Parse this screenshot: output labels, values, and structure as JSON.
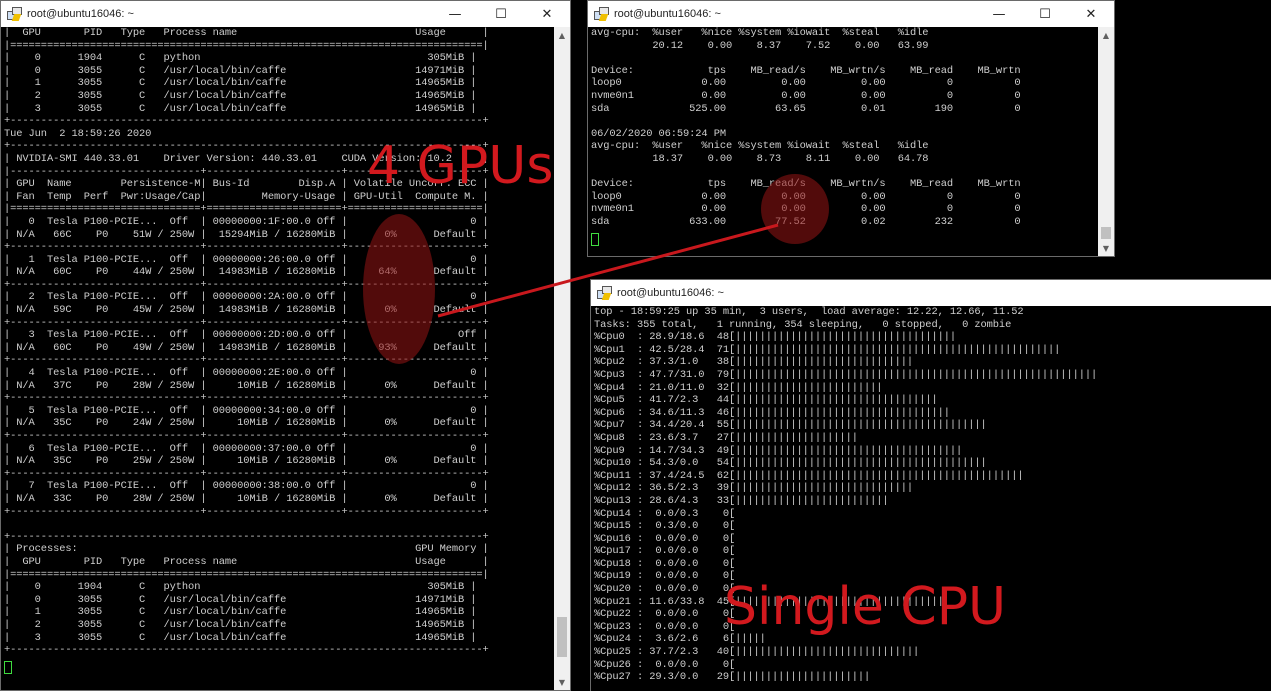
{
  "nvidia_window": {
    "title": "root@ubuntu16046: ~",
    "lines": [
      "|  GPU       PID   Type   Process name                             Usage      |",
      "|=============================================================================|",
      "|    0      1904      C   python                                     305MiB |",
      "|    0      3055      C   /usr/local/bin/caffe                     14971MiB |",
      "|    1      3055      C   /usr/local/bin/caffe                     14965MiB |",
      "|    2      3055      C   /usr/local/bin/caffe                     14965MiB |",
      "|    3      3055      C   /usr/local/bin/caffe                     14965MiB |",
      "+-----------------------------------------------------------------------------+",
      "Tue Jun  2 18:59:26 2020",
      "+-----------------------------------------------------------------------------+",
      "| NVIDIA-SMI 440.33.01    Driver Version: 440.33.01    CUDA Version: 10.2     |",
      "|-------------------------------+----------------------+----------------------+",
      "| GPU  Name        Persistence-M| Bus-Id        Disp.A | Volatile Uncorr. ECC |",
      "| Fan  Temp  Perf  Pwr:Usage/Cap|         Memory-Usage | GPU-Util  Compute M. |",
      "|===============================+======================+======================|",
      "|   0  Tesla P100-PCIE...  Off  | 00000000:1F:00.0 Off |                    0 |",
      "| N/A   66C    P0    51W / 250W |  15294MiB / 16280MiB |      0%      Default |",
      "+-------------------------------+----------------------+----------------------+",
      "|   1  Tesla P100-PCIE...  Off  | 00000000:26:00.0 Off |                    0 |",
      "| N/A   60C    P0    44W / 250W |  14983MiB / 16280MiB |     64%      Default |",
      "+-------------------------------+----------------------+----------------------+",
      "|   2  Tesla P100-PCIE...  Off  | 00000000:2A:00.0 Off |                    0 |",
      "| N/A   59C    P0    45W / 250W |  14983MiB / 16280MiB |      0%      Default |",
      "+-------------------------------+----------------------+----------------------+",
      "|   3  Tesla P100-PCIE...  Off  | 00000000:2D:00.0 Off |                  Off |",
      "| N/A   60C    P0    49W / 250W |  14983MiB / 16280MiB |     93%      Default |",
      "+-------------------------------+----------------------+----------------------+",
      "|   4  Tesla P100-PCIE...  Off  | 00000000:2E:00.0 Off |                    0 |",
      "| N/A   37C    P0    28W / 250W |     10MiB / 16280MiB |      0%      Default |",
      "+-------------------------------+----------------------+----------------------+",
      "|   5  Tesla P100-PCIE...  Off  | 00000000:34:00.0 Off |                    0 |",
      "| N/A   35C    P0    24W / 250W |     10MiB / 16280MiB |      0%      Default |",
      "+-------------------------------+----------------------+----------------------+",
      "|   6  Tesla P100-PCIE...  Off  | 00000000:37:00.0 Off |                    0 |",
      "| N/A   35C    P0    25W / 250W |     10MiB / 16280MiB |      0%      Default |",
      "+-------------------------------+----------------------+----------------------+",
      "|   7  Tesla P100-PCIE...  Off  | 00000000:38:00.0 Off |                    0 |",
      "| N/A   33C    P0    28W / 250W |     10MiB / 16280MiB |      0%      Default |",
      "+-------------------------------+----------------------+----------------------+",
      "",
      "+-----------------------------------------------------------------------------+",
      "| Processes:                                                       GPU Memory |",
      "|  GPU       PID   Type   Process name                             Usage      |",
      "|=============================================================================|",
      "|    0      1904      C   python                                     305MiB |",
      "|    0      3055      C   /usr/local/bin/caffe                     14971MiB |",
      "|    1      3055      C   /usr/local/bin/caffe                     14965MiB |",
      "|    2      3055      C   /usr/local/bin/caffe                     14965MiB |",
      "|    3      3055      C   /usr/local/bin/caffe                     14965MiB |",
      "+-----------------------------------------------------------------------------+"
    ]
  },
  "iostat_window": {
    "title": "root@ubuntu16046: ~",
    "lines": [
      "avg-cpu:  %user   %nice %system %iowait  %steal   %idle",
      "          20.12    0.00    8.37    7.52    0.00   63.99",
      "",
      "Device:            tps    MB_read/s    MB_wrtn/s    MB_read    MB_wrtn",
      "loop0             0.00         0.00         0.00          0          0",
      "nvme0n1           0.00         0.00         0.00          0          0",
      "sda             525.00        63.65         0.01        190          0",
      "",
      "06/02/2020 06:59:24 PM",
      "avg-cpu:  %user   %nice %system %iowait  %steal   %idle",
      "          18.37    0.00    8.73    8.11    0.00   64.78",
      "",
      "Device:            tps    MB_read/s    MB_wrtn/s    MB_read    MB_wrtn",
      "loop0             0.00         0.00         0.00          0          0",
      "nvme0n1           0.00         0.00         0.00          0          0",
      "sda             633.00        77.52         0.02        232          0"
    ]
  },
  "top_window": {
    "title": "root@ubuntu16046: ~",
    "summary": "top - 18:59:25 up 35 min,  3 users,  load average: 12.22, 12.66, 11.52",
    "tasks": "Tasks: 355 total,   1 running, 354 sleeping,   0 stopped,   0 zombie",
    "cpus": [
      {
        "label": "%Cpu0  :",
        "vals": " 28.9/18.6",
        "pct": 48
      },
      {
        "label": "%Cpu1  :",
        "vals": " 42.5/28.4",
        "pct": 71
      },
      {
        "label": "%Cpu2  :",
        "vals": " 37.3/1.0 ",
        "pct": 38
      },
      {
        "label": "%Cpu3  :",
        "vals": " 47.7/31.0",
        "pct": 79
      },
      {
        "label": "%Cpu4  :",
        "vals": " 21.0/11.0",
        "pct": 32
      },
      {
        "label": "%Cpu5  :",
        "vals": " 41.7/2.3 ",
        "pct": 44
      },
      {
        "label": "%Cpu6  :",
        "vals": " 34.6/11.3",
        "pct": 46
      },
      {
        "label": "%Cpu7  :",
        "vals": " 34.4/20.4",
        "pct": 55
      },
      {
        "label": "%Cpu8  :",
        "vals": " 23.6/3.7 ",
        "pct": 27
      },
      {
        "label": "%Cpu9  :",
        "vals": " 14.7/34.3",
        "pct": 49
      },
      {
        "label": "%Cpu10 :",
        "vals": " 54.3/0.0 ",
        "pct": 54
      },
      {
        "label": "%Cpu11 :",
        "vals": " 37.4/24.5",
        "pct": 62
      },
      {
        "label": "%Cpu12 :",
        "vals": " 36.5/2.3 ",
        "pct": 39
      },
      {
        "label": "%Cpu13 :",
        "vals": " 28.6/4.3 ",
        "pct": 33
      },
      {
        "label": "%Cpu14 :",
        "vals": "  0.0/0.3 ",
        "pct": 0
      },
      {
        "label": "%Cpu15 :",
        "vals": "  0.3/0.0 ",
        "pct": 0
      },
      {
        "label": "%Cpu16 :",
        "vals": "  0.0/0.0 ",
        "pct": 0
      },
      {
        "label": "%Cpu17 :",
        "vals": "  0.0/0.0 ",
        "pct": 0
      },
      {
        "label": "%Cpu18 :",
        "vals": "  0.0/0.0 ",
        "pct": 0
      },
      {
        "label": "%Cpu19 :",
        "vals": "  0.0/0.0 ",
        "pct": 0
      },
      {
        "label": "%Cpu20 :",
        "vals": "  0.0/0.0 ",
        "pct": 0
      },
      {
        "label": "%Cpu21 :",
        "vals": " 11.6/33.8",
        "pct": 45
      },
      {
        "label": "%Cpu22 :",
        "vals": "  0.0/0.0 ",
        "pct": 0
      },
      {
        "label": "%Cpu23 :",
        "vals": "  0.0/0.0 ",
        "pct": 0
      },
      {
        "label": "%Cpu24 :",
        "vals": "  3.6/2.6 ",
        "pct": 6
      },
      {
        "label": "%Cpu25 :",
        "vals": " 37.7/2.3 ",
        "pct": 40
      },
      {
        "label": "%Cpu26 :",
        "vals": "  0.0/0.0 ",
        "pct": 0
      },
      {
        "label": "%Cpu27 :",
        "vals": " 29.3/0.0 ",
        "pct": 29
      }
    ]
  },
  "annotations": {
    "gpus_label": "4 GPUs",
    "cpu_label": "Single CPU",
    "color": "#d2191e"
  },
  "window_controls": {
    "minimize": "—",
    "maximize": "☐",
    "close": "✕"
  },
  "scroll_arrows": {
    "up": "▲",
    "down": "▼"
  }
}
